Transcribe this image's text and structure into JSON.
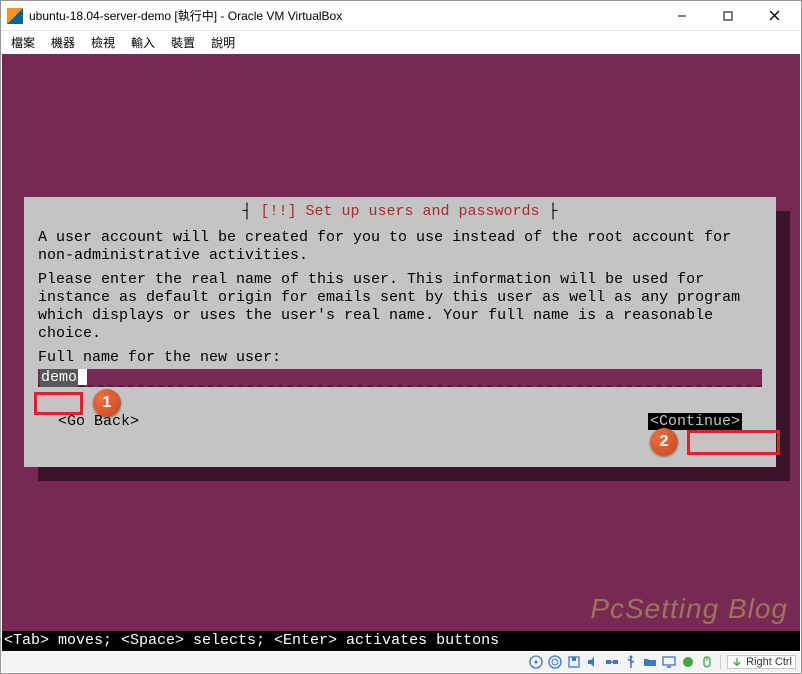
{
  "window": {
    "title": "ubuntu-18.04-server-demo [執行中] - Oracle VM VirtualBox"
  },
  "menubar": {
    "items": [
      "檔案",
      "機器",
      "檢視",
      "輸入",
      "裝置",
      "說明"
    ]
  },
  "installer": {
    "title_prefix": "┤",
    "title_suffix": "├",
    "title": " [!!] Set up users and passwords ",
    "paragraph1": "A user account will be created for you to use instead of the root account for non-administrative activities.",
    "paragraph2": "Please enter the real name of this user. This information will be used for instance as default origin for emails sent by this user as well as any program which displays or uses the user's real name. Your full name is a reasonable choice.",
    "prompt": "Full name for the new user:",
    "input_value": "demo",
    "go_back": "<Go Back>",
    "continue": "<Continue>"
  },
  "helpbar": {
    "text": "<Tab> moves; <Space> selects; <Enter> activates buttons"
  },
  "statusbar": {
    "hostkey": "Right Ctrl"
  },
  "watermark": "PcSetting Blog",
  "annotations": {
    "badge1": "1",
    "badge2": "2"
  }
}
